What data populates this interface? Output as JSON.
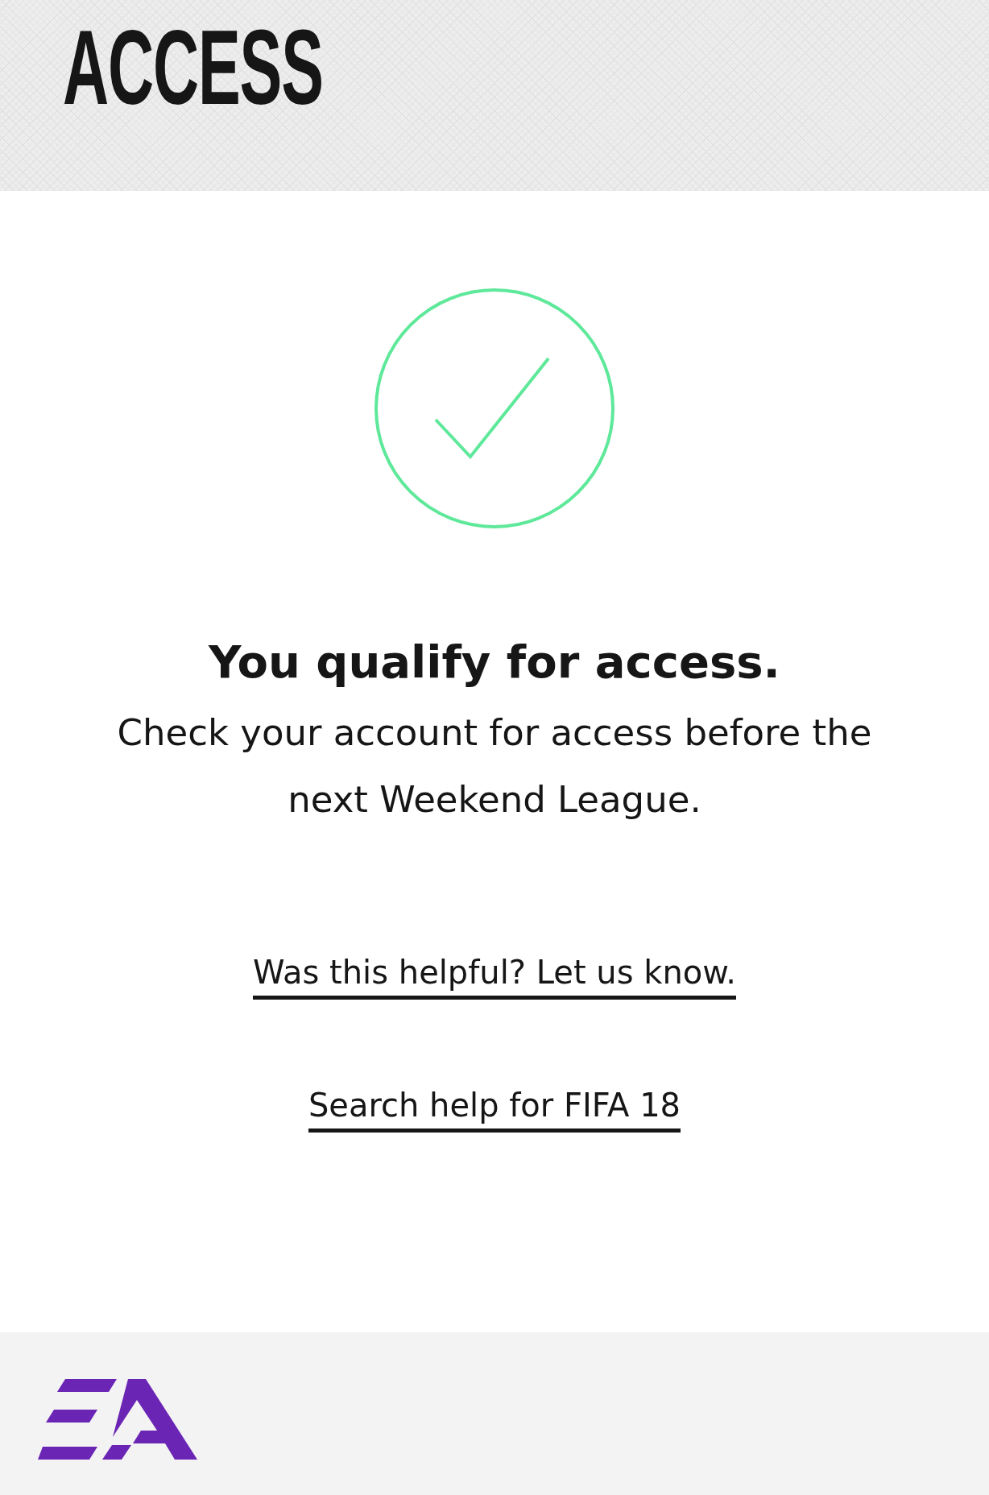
{
  "header": {
    "title": "ACCESS"
  },
  "result": {
    "heading": "You qualify for access.",
    "message": "Check your account for access before the next Weekend League."
  },
  "links": [
    {
      "label": "Was this helpful? Let us know."
    },
    {
      "label": "Search help for FIFA 18"
    }
  ]
}
